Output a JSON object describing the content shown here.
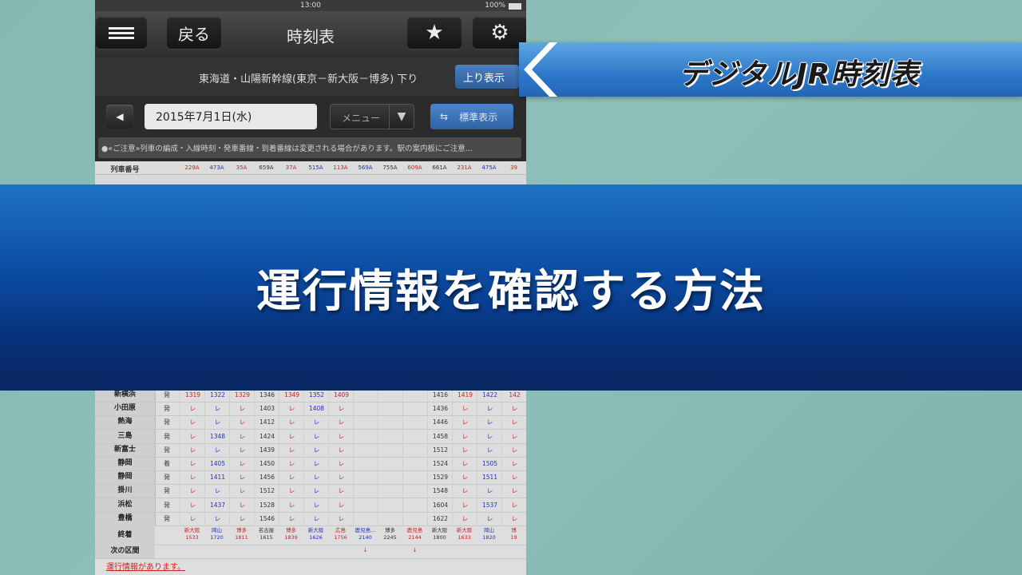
{
  "status_bar": {
    "time": "13:00",
    "battery": "100%"
  },
  "nav": {
    "back_label": "戻る",
    "title": "時刻表"
  },
  "route": {
    "name": "東海道・山陽新幹線(東京－新大阪－博多) 下り",
    "up_button": "上り表示"
  },
  "date_bar": {
    "prev_glyph": "◀",
    "date": "2015年7月1日(水)",
    "menu_label": "メニュー",
    "menu_arrow": "▼",
    "standard_label": "標準表示",
    "standard_glyph": "⇆"
  },
  "notice": "●«ご注意»列車の編成・入線時刻・発車番線・到着番線は変更される場合があります。駅の案内板にご注意...",
  "train_numbers": {
    "label": "列車番号",
    "values": [
      "229A",
      "473A",
      "35A",
      "659A",
      "37A",
      "515A",
      "113A",
      "569A",
      "755A",
      "609A",
      "661A",
      "231A",
      "475A",
      "39"
    ],
    "colors": [
      "red",
      "blue",
      "red",
      "blk",
      "red",
      "blue",
      "red",
      "blue",
      "blk",
      "red",
      "blk",
      "red",
      "blue",
      "red"
    ]
  },
  "timetable": {
    "rows": [
      {
        "station": "新横浜",
        "kind": "発",
        "cells": [
          "1319",
          "1322",
          "1329",
          "1346",
          "1349",
          "1352",
          "1409",
          "",
          "",
          "",
          "1416",
          "1419",
          "1422",
          "142"
        ]
      },
      {
        "station": "小田原",
        "kind": "発",
        "cells": [
          "レ",
          "レ",
          "レ",
          "1403",
          "レ",
          "1408",
          "レ",
          "",
          "",
          "",
          "1436",
          "レ",
          "レ",
          "レ"
        ]
      },
      {
        "station": "熱海",
        "kind": "発",
        "cells": [
          "レ",
          "レ",
          "レ",
          "1412",
          "レ",
          "レ",
          "レ",
          "",
          "",
          "",
          "1446",
          "レ",
          "レ",
          "レ"
        ]
      },
      {
        "station": "三島",
        "kind": "発",
        "cells": [
          "レ",
          "1348",
          "レ",
          "1424",
          "レ",
          "レ",
          "レ",
          "",
          "",
          "",
          "1458",
          "レ",
          "レ",
          "レ"
        ]
      },
      {
        "station": "新富士",
        "kind": "発",
        "cells": [
          "レ",
          "レ",
          "レ",
          "1439",
          "レ",
          "レ",
          "レ",
          "",
          "",
          "",
          "1512",
          "レ",
          "レ",
          "レ"
        ]
      },
      {
        "station": "静岡",
        "kind": "着",
        "cells": [
          "レ",
          "1405",
          "レ",
          "1450",
          "レ",
          "レ",
          "レ",
          "",
          "",
          "",
          "1524",
          "レ",
          "1505",
          "レ"
        ]
      },
      {
        "station": "静岡",
        "kind": "発",
        "cells": [
          "レ",
          "1411",
          "レ",
          "1456",
          "レ",
          "レ",
          "レ",
          "",
          "",
          "",
          "1529",
          "レ",
          "1511",
          "レ"
        ]
      },
      {
        "station": "掛川",
        "kind": "発",
        "cells": [
          "レ",
          "レ",
          "レ",
          "1512",
          "レ",
          "レ",
          "レ",
          "",
          "",
          "",
          "1548",
          "レ",
          "レ",
          "レ"
        ]
      },
      {
        "station": "浜松",
        "kind": "発",
        "cells": [
          "レ",
          "1437",
          "レ",
          "1528",
          "レ",
          "レ",
          "レ",
          "",
          "",
          "",
          "1604",
          "レ",
          "1537",
          "レ"
        ]
      },
      {
        "station": "豊橋",
        "kind": "発",
        "cells": [
          "レ",
          "レ",
          "レ",
          "1546",
          "レ",
          "レ",
          "レ",
          "",
          "",
          "",
          "1622",
          "レ",
          "レ",
          "レ"
        ]
      }
    ],
    "dest_label": "終着",
    "destinations": [
      [
        "新大阪",
        "1533"
      ],
      [
        "岡山",
        "1720"
      ],
      [
        "博多",
        "1811"
      ],
      [
        "名古屋",
        "1615"
      ],
      [
        "博多",
        "1839"
      ],
      [
        "新大阪",
        "1626"
      ],
      [
        "広島",
        "1756"
      ],
      [
        "鹿児島...",
        "2140"
      ],
      [
        "博多",
        "2245"
      ],
      [
        "鹿児島",
        "2144"
      ],
      [
        "新大阪",
        "1800"
      ],
      [
        "新大阪",
        "1633"
      ],
      [
        "岡山",
        "1820"
      ],
      [
        "博",
        "19"
      ]
    ],
    "next_label": "次の区間",
    "next_marks": [
      "",
      "",
      "",
      "",
      "",
      "",
      "",
      "↓",
      "",
      "↓",
      "",
      "",
      "",
      ""
    ],
    "info_link": "運行情報があります。"
  },
  "banner_title": "運行情報を確認する方法",
  "logo": "デジタルJR時刻表"
}
